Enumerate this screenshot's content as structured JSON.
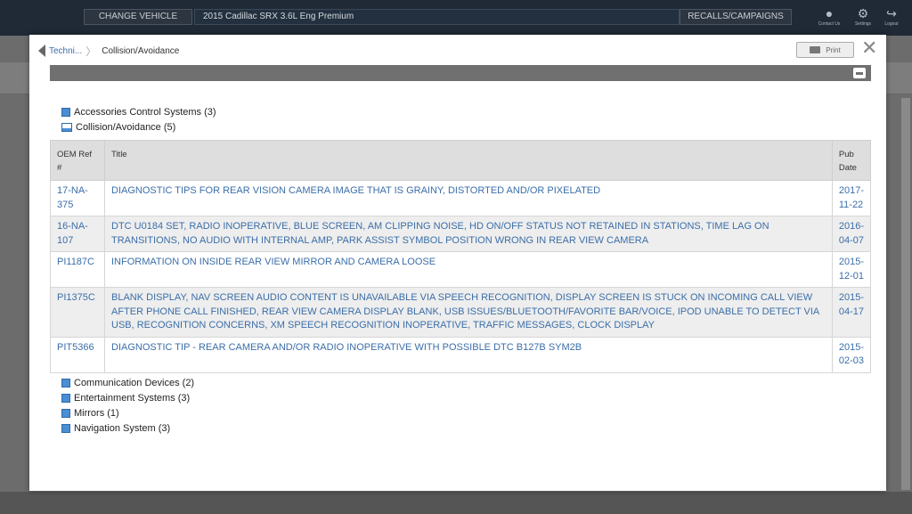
{
  "app_bar": {
    "change_vehicle": "CHANGE VEHICLE",
    "vehicle": "2015 Cadillac SRX 3.6L Eng Premium",
    "recalls": "RECALLS/CAMPAIGNS",
    "contact": "Contact Us",
    "settings": "Settings",
    "logout": "Logout"
  },
  "modal": {
    "breadcrumb": {
      "back": "Techni...",
      "current": "Collision/Avoidance"
    },
    "print_label": "Print",
    "close_glyph": "✕"
  },
  "categories_before": [
    {
      "label": "Accessories Control Systems (3)",
      "open": false
    },
    {
      "label": "Collision/Avoidance (5)",
      "open": true
    }
  ],
  "table": {
    "headers": {
      "ref": "OEM Ref #",
      "title": "Title",
      "date": "Pub Date"
    },
    "rows": [
      {
        "ref": "17-NA-375",
        "title": "DIAGNOSTIC TIPS FOR REAR VISION CAMERA IMAGE THAT IS GRAINY, DISTORTED AND/OR PIXELATED",
        "date": "2017-11-22"
      },
      {
        "ref": "16-NA-107",
        "title": "DTC U0184 SET, RADIO INOPERATIVE, BLUE SCREEN, AM CLIPPING NOISE, HD ON/OFF STATUS NOT RETAINED IN STATIONS, TIME LAG ON TRANSITIONS, NO AUDIO WITH INTERNAL AMP, PARK ASSIST SYMBOL POSITION WRONG IN REAR VIEW CAMERA",
        "date": "2016-04-07"
      },
      {
        "ref": "PI1187C",
        "title": "INFORMATION ON INSIDE REAR VIEW MIRROR AND CAMERA LOOSE",
        "date": "2015-12-01"
      },
      {
        "ref": "PI1375C",
        "title": "BLANK DISPLAY, NAV SCREEN AUDIO CONTENT IS UNAVAILABLE VIA SPEECH RECOGNITION, DISPLAY SCREEN IS STUCK ON INCOMING CALL VIEW AFTER PHONE CALL FINISHED, REAR VIEW CAMERA DISPLAY BLANK, USB ISSUES/BLUETOOTH/FAVORITE BAR/VOICE, IPOD UNABLE TO DETECT VIA USB, RECOGNITION CONCERNS, XM SPEECH RECOGNITION INOPERATIVE, TRAFFIC MESSAGES, CLOCK DISPLAY",
        "date": "2015-04-17"
      },
      {
        "ref": "PIT5366",
        "title": "DIAGNOSTIC TIP - REAR CAMERA AND/OR RADIO INOPERATIVE WITH POSSIBLE DTC B127B SYM2B",
        "date": "2015-02-03"
      }
    ]
  },
  "categories_after": [
    {
      "label": "Communication Devices (2)"
    },
    {
      "label": "Entertainment Systems (3)"
    },
    {
      "label": "Mirrors (1)"
    },
    {
      "label": "Navigation System (3)"
    }
  ],
  "colors": {
    "link": "#3b6ea8",
    "header_bar": "#1f2a36",
    "gray_bar": "#707070"
  }
}
